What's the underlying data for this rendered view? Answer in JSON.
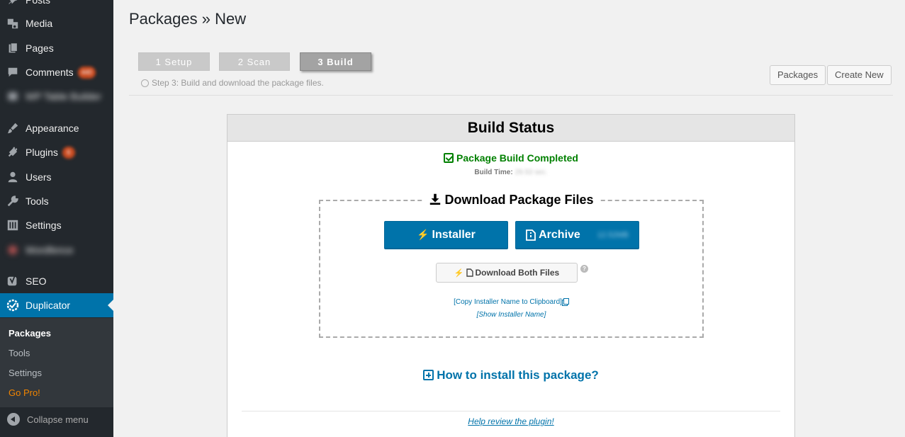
{
  "sidebar": {
    "items": [
      {
        "label": "Posts",
        "icon": "pin-icon"
      },
      {
        "label": "Media",
        "icon": "media-icon"
      },
      {
        "label": "Pages",
        "icon": "pages-icon"
      },
      {
        "label": "Comments",
        "icon": "comments-icon",
        "badge": "440"
      },
      {
        "label": "WP Table Builder",
        "icon": "table-icon"
      },
      {
        "label": "Appearance",
        "icon": "brush-icon"
      },
      {
        "label": "Plugins",
        "icon": "plugin-icon",
        "badge": "6"
      },
      {
        "label": "Users",
        "icon": "user-icon"
      },
      {
        "label": "Tools",
        "icon": "wrench-icon"
      },
      {
        "label": "Settings",
        "icon": "settings-icon"
      },
      {
        "label": "Wordfence",
        "icon": "shield-icon"
      },
      {
        "label": "SEO",
        "icon": "yoast-icon"
      },
      {
        "label": "Duplicator",
        "icon": "duplicator-icon"
      }
    ],
    "submenu": [
      "Packages",
      "Tools",
      "Settings",
      "Go Pro!"
    ],
    "collapse_label": "Collapse menu"
  },
  "header": {
    "title": "Packages » New",
    "steps": [
      "1 Setup",
      "2 Scan",
      "3 Build"
    ],
    "step_desc": "Step 3: Build and download the package files.",
    "packages_btn": "Packages",
    "create_new_btn": "Create New"
  },
  "panel": {
    "title": "Build Status",
    "status": "Package Build Completed",
    "build_time_label": "Build Time:",
    "build_time_value": "29.53 sec.",
    "download_title": "Download Package Files",
    "installer_btn": "Installer",
    "archive_btn": "Archive",
    "archive_size": "12.52MB",
    "both_btn": "Download Both Files",
    "copy_link": "[Copy Installer Name to Clipboard]",
    "show_link": "[Show Installer Name]",
    "howto": "How to install this package?",
    "review": "Help review the plugin!"
  },
  "colors": {
    "accent": "#0073aa",
    "success": "#008000",
    "sidebar_bg": "#23282d",
    "gopro": "#f18500"
  }
}
